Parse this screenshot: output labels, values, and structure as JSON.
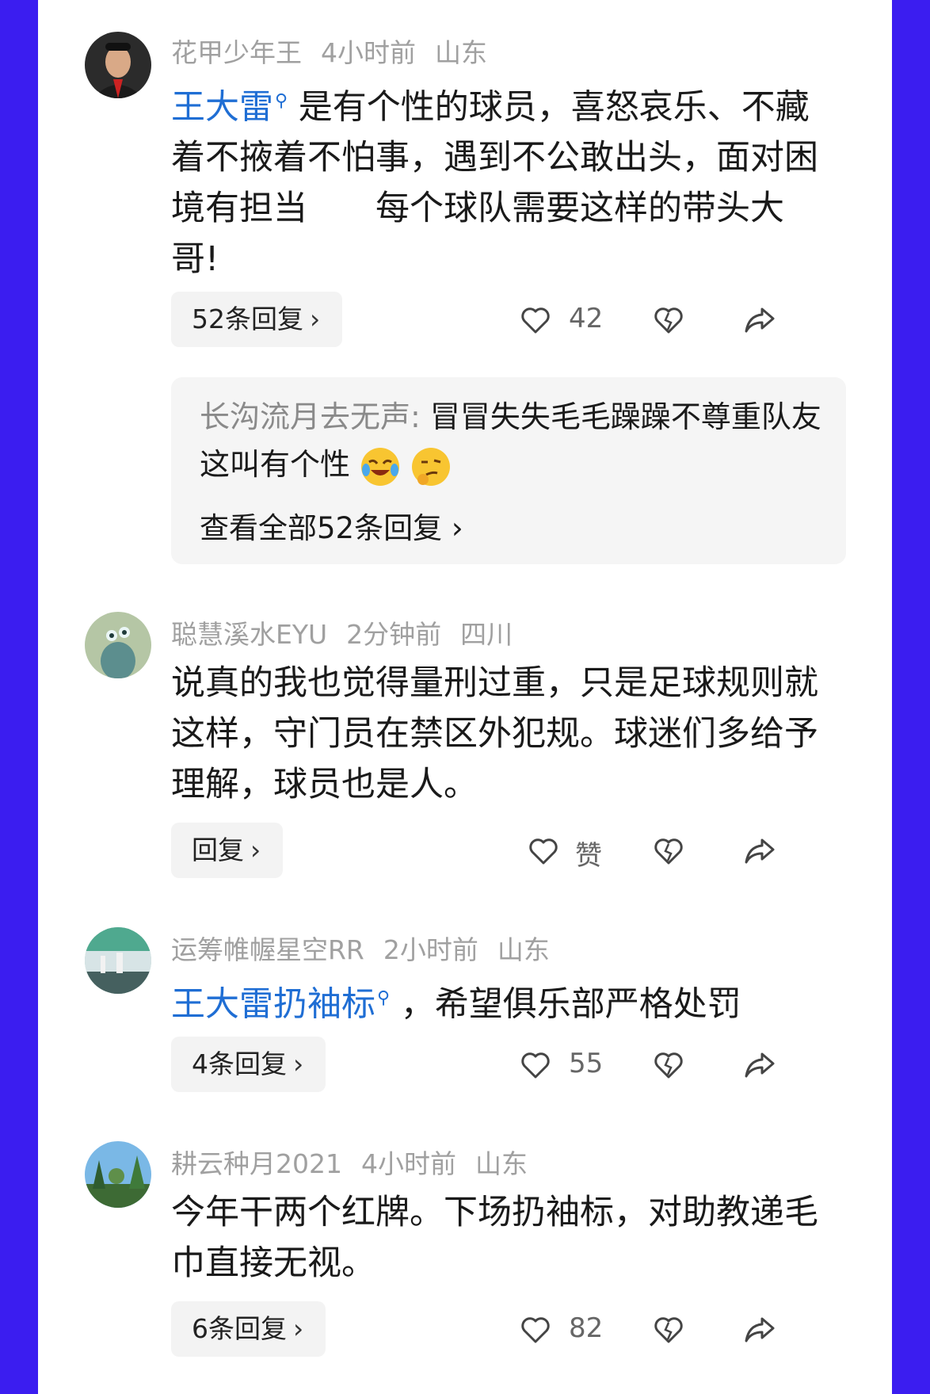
{
  "comments": [
    {
      "username": "花甲少年王",
      "time": "4小时前",
      "location": "山东",
      "mention": "王大雷",
      "text": "是有个性的球员，喜怒哀乐、不藏着不掖着不怕事，遇到不公敢出头，面对困境有担当　　每个球队需要这样的带头大哥!",
      "reply_label": "52条回复",
      "like_count": "42",
      "sub_reply": {
        "user": "长沟流月去无声:",
        "text": "冒冒失失毛毛躁躁不尊重队友这叫有个性",
        "view_all": "查看全部52条回复"
      }
    },
    {
      "username": "聪慧溪水EYU",
      "time": "2分钟前",
      "location": "四川",
      "text": "说真的我也觉得量刑过重，只是足球规则就这样，守门员在禁区外犯规。球迷们多给予理解，球员也是人。",
      "reply_label": "回复",
      "like_count": "赞"
    },
    {
      "username": "运筹帷幄星空RR",
      "time": "2小时前",
      "location": "山东",
      "mention": "王大雷扔袖标",
      "text": "，希望俱乐部严格处罚",
      "reply_label": "4条回复",
      "like_count": "55"
    },
    {
      "username": "耕云种月2021",
      "time": "4小时前",
      "location": "山东",
      "text": "今年干两个红牌。下场扔袖标，对助教递毛巾直接无视。",
      "reply_label": "6条回复",
      "like_count": "82"
    }
  ],
  "icons": {
    "like": "heart-outline-icon",
    "dislike": "broken-heart-icon",
    "share": "share-arrow-icon",
    "mention": "search-icon",
    "chevron": "chevron-right-icon"
  },
  "colors": {
    "background": "#3b1df0",
    "mention": "#1f6ed4",
    "meta": "#a0a0a0"
  }
}
